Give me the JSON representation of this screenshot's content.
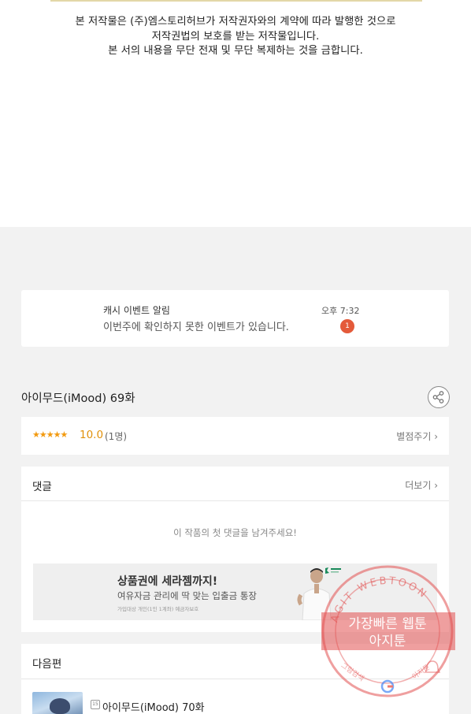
{
  "copyright": {
    "line1": "본 저작물은 (주)엠스토리허브가 저작권자와의 계약에 따라 발행한 것으로",
    "line2": "저작권법의 보호를 받는 저작물입니다.",
    "line3": "본 서의 내용을 무단 전재 및 무단 복제하는 것을 금합니다."
  },
  "notification": {
    "title": "캐시 이벤트 알림",
    "message": "이번주에 확인하지 못한 이벤트가 있습니다.",
    "time": "오후 7:32",
    "badge": "1"
  },
  "episode": {
    "title": "아이무드(iMood) 69화"
  },
  "rating": {
    "stars": "★★★★★",
    "score": "10.0",
    "count": "(1명)",
    "rate_label": "별점주기"
  },
  "comments": {
    "label": "댓글",
    "more_label": "더보기",
    "empty_message": "이 작품의 첫 댓글을 남겨주세요!"
  },
  "ad": {
    "headline": "상품권에 세라젬까지!",
    "sub": "여유자금 관리에 딱 맞는 입출금 통장",
    "fine": "가입대상 개인(1인 1계좌) 예금자보호"
  },
  "next": {
    "label": "다음편",
    "age": "15",
    "episode_title": "아이무드(iMood) 70화"
  },
  "watermark": {
    "arc_text": "AGIT WEBTOON",
    "line1": "가장빠른 웹툰",
    "line2": "아지툰",
    "bottom_left": "그림검색",
    "bottom_right": "아지툰"
  },
  "colors": {
    "accent_star": "#f29a10",
    "badge": "#e45a3a",
    "stamp": "#e25050"
  }
}
